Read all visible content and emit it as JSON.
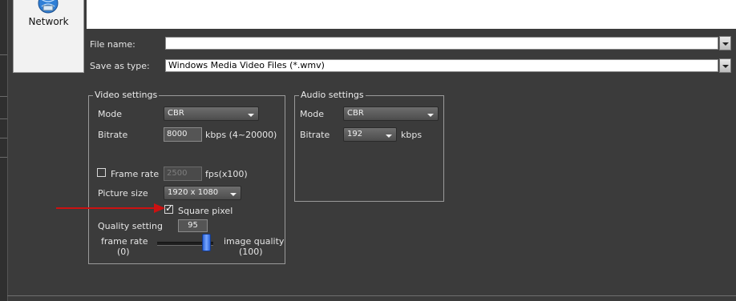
{
  "places": {
    "network_label": "Network"
  },
  "file_name": {
    "label": "File name:",
    "value": ""
  },
  "save_as_type": {
    "label": "Save as type:",
    "value": "Windows Media Video Files (*.wmv)"
  },
  "video_settings": {
    "title": "Video settings",
    "mode_label": "Mode",
    "mode_value": "CBR",
    "bitrate_label": "Bitrate",
    "bitrate_value": "8000",
    "bitrate_unit": "kbps (4~20000)",
    "frame_rate_label": "Frame rate",
    "frame_rate_checked": false,
    "frame_rate_value": "2500",
    "frame_rate_unit": "fps(x100)",
    "picture_size_label": "Picture size",
    "picture_size_value": "1920 x 1080",
    "square_pixel_label": "Square pixel",
    "square_pixel_checked": true,
    "quality_setting_label": "Quality setting",
    "quality_setting_value": "95",
    "slider_left_label": "frame rate",
    "slider_left_value": "(0)",
    "slider_right_label": "image quality",
    "slider_right_value": "(100)",
    "slider_position": 0.95
  },
  "audio_settings": {
    "title": "Audio settings",
    "mode_label": "Mode",
    "mode_value": "CBR",
    "bitrate_label": "Bitrate",
    "bitrate_value": "192",
    "bitrate_unit": "kbps"
  },
  "icons": {
    "network": "network-icon",
    "dropdown": "chevron-down-icon",
    "annotation": "red-arrow-icon"
  },
  "colors": {
    "background": "#3b3b3b",
    "slider_thumb": "#3a74ee",
    "annotation_arrow": "#cc1111"
  }
}
